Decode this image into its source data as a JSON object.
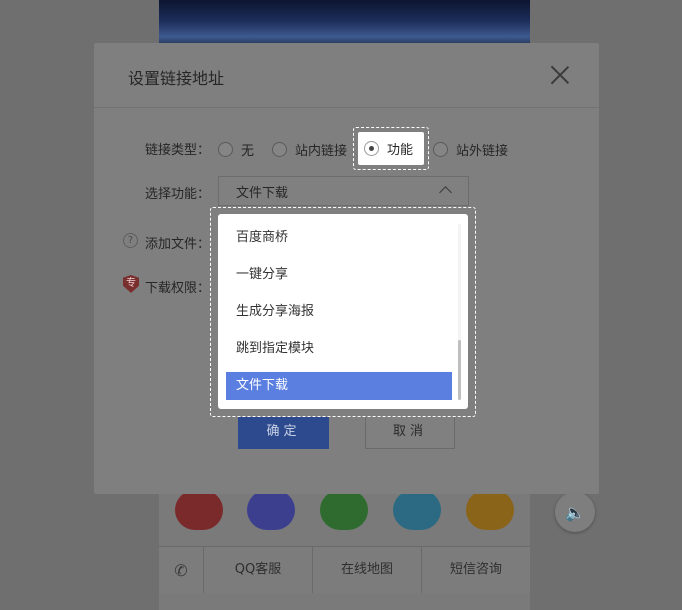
{
  "dialog": {
    "title": "设置链接地址",
    "link_type_label": "链接类型：",
    "link_type_options": [
      "无",
      "站内链接",
      "功能",
      "站外链接"
    ],
    "link_type_selected": "功能",
    "select_function_label": "选择功能：",
    "select_function_value": "文件下载",
    "add_file_label": "添加文件：",
    "download_permission_label": "下载权限：",
    "pro_badge": "专",
    "ok_label": "确定",
    "cancel_label": "取消"
  },
  "dropdown": {
    "items": [
      "百度商桥",
      "一键分享",
      "生成分享海报",
      "跳到指定模块",
      "文件下载"
    ],
    "active_item": "文件下载"
  },
  "phone": {
    "footer_items": [
      "QQ客服",
      "在线地图",
      "短信咨询"
    ]
  },
  "colors": {
    "accent": "#5b7fe0",
    "ok_button": "#2d4a8e",
    "overlay": "#6f6f6f"
  }
}
